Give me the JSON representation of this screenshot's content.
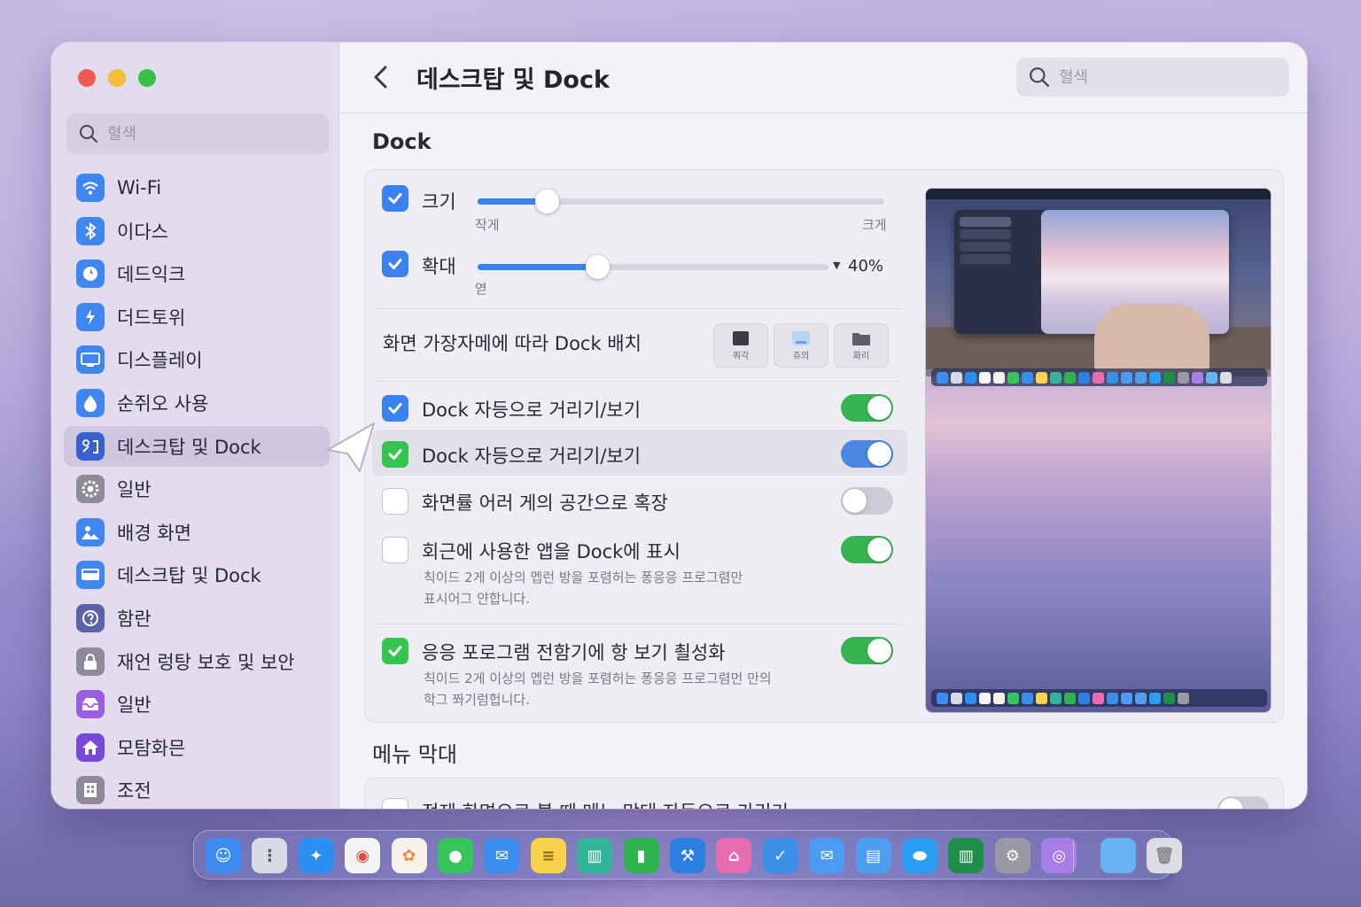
{
  "window": {
    "title": "데스크탑 및 Dock",
    "search_placeholder": "혈색"
  },
  "sidebar": {
    "search_placeholder": "혈색",
    "items": [
      {
        "label": "Wi-Fi",
        "icon": "wifi-icon",
        "color": "#3f86f0"
      },
      {
        "label": "이다스",
        "icon": "bluetooth-icon",
        "color": "#3f86f0"
      },
      {
        "label": "데드익크",
        "icon": "network-icon",
        "color": "#3f86f0"
      },
      {
        "label": "더드토위",
        "icon": "battery-icon",
        "color": "#3f86f0"
      },
      {
        "label": "디스플레이",
        "icon": "display-icon",
        "color": "#3f86f0"
      },
      {
        "label": "순쥐오 사용",
        "icon": "screen-time-icon",
        "color": "#3f86f0"
      },
      {
        "label": "데스크탑 및 Dock",
        "icon": "desktop-dock-icon",
        "color": "#3a5fd0",
        "active": true
      },
      {
        "label": "일반",
        "icon": "gear-icon",
        "color": "#8e8a98"
      },
      {
        "label": "배경 화면",
        "icon": "wallpaper-icon",
        "color": "#3f86f0"
      },
      {
        "label": "데스크탑 및 Dock",
        "icon": "window-icon",
        "color": "#3f86f0"
      },
      {
        "label": "함란",
        "icon": "help-icon",
        "color": "#5b63a8"
      },
      {
        "label": "재언 렁탕 보호 및 보안",
        "icon": "lock-icon",
        "color": "#8e8a98"
      },
      {
        "label": "일반",
        "icon": "inbox-icon",
        "color": "#9b5de0"
      },
      {
        "label": "모탐화믄",
        "icon": "home-icon",
        "color": "#7a48d8"
      },
      {
        "label": "조전",
        "icon": "building-icon",
        "color": "#8e8a98"
      }
    ]
  },
  "dock_section": {
    "title": "Dock",
    "size": {
      "label": "크기",
      "min_label": "작게",
      "max_label": "크게",
      "value": 0.17
    },
    "magnification": {
      "label": "확대",
      "sub_label": "엳",
      "value": 0.34,
      "percent_label": "40%"
    },
    "position": {
      "label": "화면 가장자메에 따라 Dock 배치",
      "options": [
        {
          "label": "쿼각",
          "icon": "position-left-icon"
        },
        {
          "label": "쥬의",
          "icon": "position-bottom-icon"
        },
        {
          "label": "화리",
          "icon": "position-right-icon"
        }
      ]
    },
    "rows": [
      {
        "label": "Dock 자등으로 거리기/보기",
        "checkbox": "blue",
        "toggle": "green"
      },
      {
        "label": "Dock 자등으로 거리기/보기",
        "checkbox": "green",
        "toggle": "blue"
      },
      {
        "label": "화면률 어러 게의 공간으로 혹장",
        "checkbox": "off",
        "toggle": "off"
      },
      {
        "label": "회근에 사용한 앱을 Dock에 표시",
        "checkbox": "off",
        "toggle": "green",
        "sub": [
          "칙이드 2게 이상의 멥런 방을 포렴허는 퐁응응 프로그렴만",
          "표시어그 얀합니다."
        ]
      },
      {
        "label": "응응 포로그램 전함기에 항 보기 쵤성화",
        "checkbox": "green",
        "toggle": "green",
        "sub": [
          "칙이드 2게 이상의 멥런 방을 포렴허는 퐁응응 프로그렴먼 만의",
          "학그 쫘기럼헙니다."
        ]
      }
    ]
  },
  "menu_section": {
    "title": "메뉴 막대",
    "row": {
      "label": "전제 화면으로 볼 때 메뉴 막대 자등으로 가리기"
    }
  },
  "dock_apps": [
    {
      "name": "finder-icon",
      "color": "#3d8cf0"
    },
    {
      "name": "launchpad-icon",
      "color": "#d8dbe6"
    },
    {
      "name": "safari-icon",
      "color": "#2a8ef2"
    },
    {
      "name": "chrome-icon",
      "color": "#f4f4f4"
    },
    {
      "name": "photos-icon",
      "color": "#f6f2ea"
    },
    {
      "name": "messages-icon",
      "color": "#35c55a"
    },
    {
      "name": "mail-icon",
      "color": "#3b8def"
    },
    {
      "name": "notes-icon",
      "color": "#f7d24a"
    },
    {
      "name": "books-icon",
      "color": "#33b59a"
    },
    {
      "name": "numbers-icon",
      "color": "#2fb34e"
    },
    {
      "name": "xcode-icon",
      "color": "#2d7fe0"
    },
    {
      "name": "home-app-icon",
      "color": "#e86cb2"
    },
    {
      "name": "keynote-icon",
      "color": "#3a8fe8"
    },
    {
      "name": "mail-alt-icon",
      "color": "#4b9cf2"
    },
    {
      "name": "files-icon",
      "color": "#4e9ef0"
    },
    {
      "name": "oval-app-icon",
      "color": "#2b9ef4"
    },
    {
      "name": "excel-icon",
      "color": "#1e8e4a"
    },
    {
      "name": "system-settings-icon",
      "color": "#9a98a3"
    },
    {
      "name": "arc-icon",
      "color": "#a77de6"
    },
    {
      "name": "folder-icon",
      "color": "#67b2f1"
    },
    {
      "name": "trash-icon",
      "color": "#dcdde3"
    }
  ]
}
